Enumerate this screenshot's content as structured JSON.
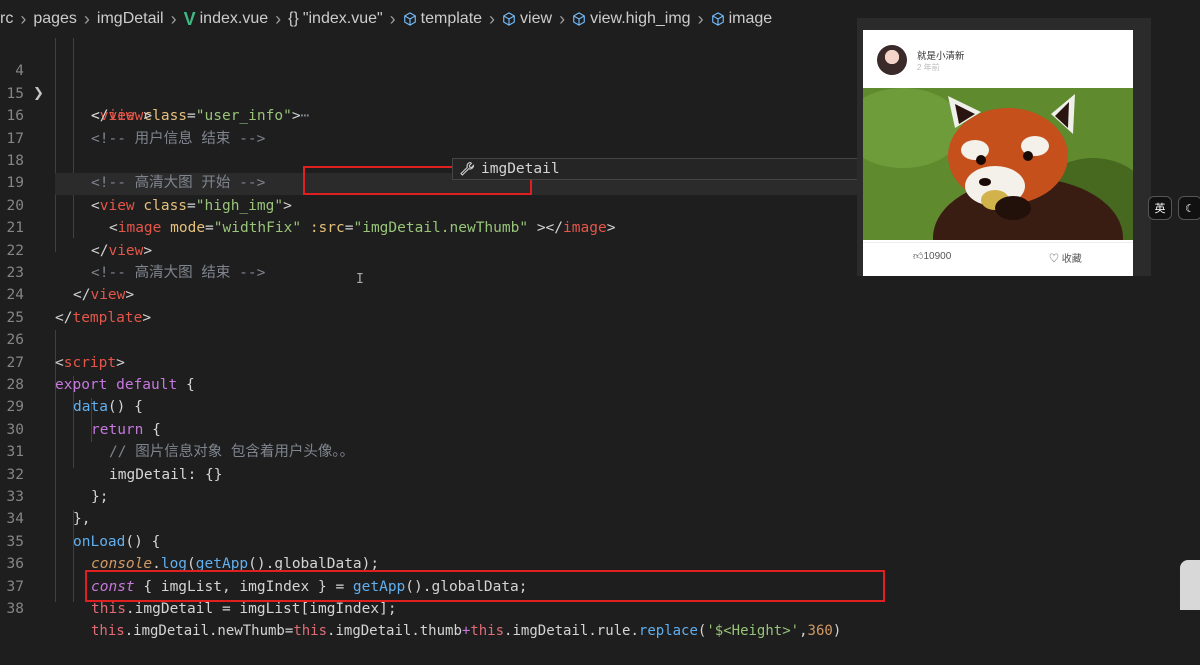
{
  "breadcrumb": {
    "items": [
      {
        "label": "rc",
        "icon": "none"
      },
      {
        "label": "pages",
        "icon": "none"
      },
      {
        "label": "imgDetail",
        "icon": "none"
      },
      {
        "label": "index.vue",
        "icon": "vue-icon"
      },
      {
        "label": "\"index.vue\"",
        "icon": "braces-icon"
      },
      {
        "label": "template",
        "icon": "cube-icon"
      },
      {
        "label": "view",
        "icon": "cube-icon"
      },
      {
        "label": "view.high_img",
        "icon": "cube-icon"
      },
      {
        "label": "image",
        "icon": "cube-icon"
      }
    ]
  },
  "editor": {
    "lines": [
      {
        "num": "4",
        "folded": true,
        "text": "<view class=\"user_info\">⋯"
      },
      {
        "num": "15",
        "text": "</view>"
      },
      {
        "num": "16",
        "text": "<!-- 用户信息 结束 -->"
      },
      {
        "num": "17",
        "text": ""
      },
      {
        "num": "18",
        "text": "<!-- 高清大图 开始 -->"
      },
      {
        "num": "19",
        "text": "<view class=\"high_img\">"
      },
      {
        "num": "20",
        "text": "<image mode=\"widthFix\" :src=\"imgDetail.newThumb\" ></image>"
      },
      {
        "num": "21",
        "text": "</view>"
      },
      {
        "num": "22",
        "text": "<!-- 高清大图 结束 -->"
      },
      {
        "num": "23",
        "text": "</view>"
      },
      {
        "num": "24",
        "text": "</template>"
      },
      {
        "num": "25",
        "text": ""
      },
      {
        "num": "26",
        "text": "<script>"
      },
      {
        "num": "27",
        "text": "export default {"
      },
      {
        "num": "28",
        "text": "data() {"
      },
      {
        "num": "29",
        "text": "return {"
      },
      {
        "num": "30",
        "text": "// 图片信息对象 包含着用户头像。。"
      },
      {
        "num": "31",
        "text": "imgDetail: {}"
      },
      {
        "num": "32",
        "text": "};"
      },
      {
        "num": "33",
        "text": "},"
      },
      {
        "num": "34",
        "text": "onLoad() {"
      },
      {
        "num": "35",
        "text": "console.log(getApp().globalData);"
      },
      {
        "num": "36",
        "text": "const { imgList, imgIndex } = getApp().globalData;"
      },
      {
        "num": "37",
        "text": "this.imgDetail = imgList[imgIndex];"
      },
      {
        "num": "38",
        "text": "this.imgDetail.newThumb=this.imgDetail.thumb+this.imgDetail.rule.replace('$<Height>',360)"
      }
    ],
    "suggestion": {
      "label": "imgDetail",
      "icon": "wrench-icon"
    }
  },
  "preview": {
    "username": "就是小清新",
    "time_ago": "2 年前",
    "likes": "10900",
    "favorite_label": "收藏",
    "lang_button": "英",
    "theme_button": "☾"
  },
  "colors": {
    "highlight_box": "#e02020",
    "background": "#1e1e1e"
  }
}
